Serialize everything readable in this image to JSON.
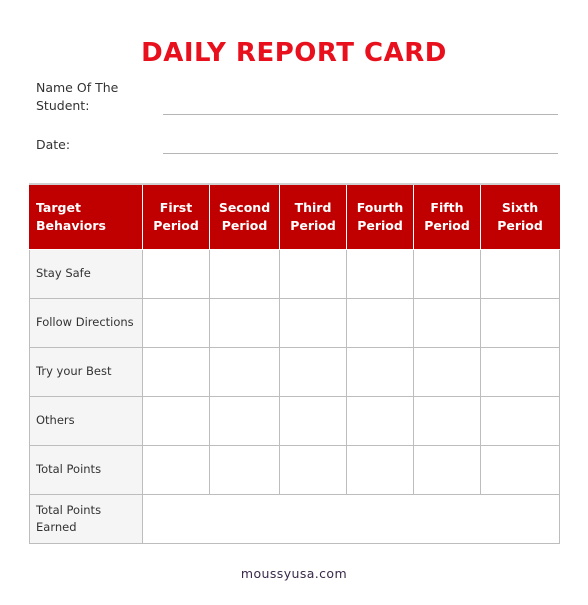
{
  "title": "DAILY REPORT CARD",
  "fields": {
    "name_label": "Name Of The Student:",
    "name_value": "",
    "date_label": "Date:",
    "date_value": ""
  },
  "table": {
    "header": [
      "Target Behaviors",
      "First Period",
      "Second Period",
      "Third Period",
      "Fourth Period",
      "Fifth Period",
      "Sixth Period"
    ],
    "rows": [
      {
        "label": "Stay Safe",
        "cells": [
          "",
          "",
          "",
          "",
          "",
          ""
        ]
      },
      {
        "label": "Follow Directions",
        "cells": [
          "",
          "",
          "",
          "",
          "",
          ""
        ]
      },
      {
        "label": "Try your Best",
        "cells": [
          "",
          "",
          "",
          "",
          "",
          ""
        ]
      },
      {
        "label": "Others",
        "cells": [
          "",
          "",
          "",
          "",
          "",
          ""
        ]
      },
      {
        "label": "Total Points",
        "cells": [
          "",
          "",
          "",
          "",
          "",
          ""
        ]
      }
    ],
    "total_earned": {
      "label": "Total Points Earned",
      "value": ""
    }
  },
  "footer": "moussyusa.com",
  "colors": {
    "title": "#e8101c",
    "header_bg": "#c00000",
    "label_bg": "#f5f5f5"
  }
}
